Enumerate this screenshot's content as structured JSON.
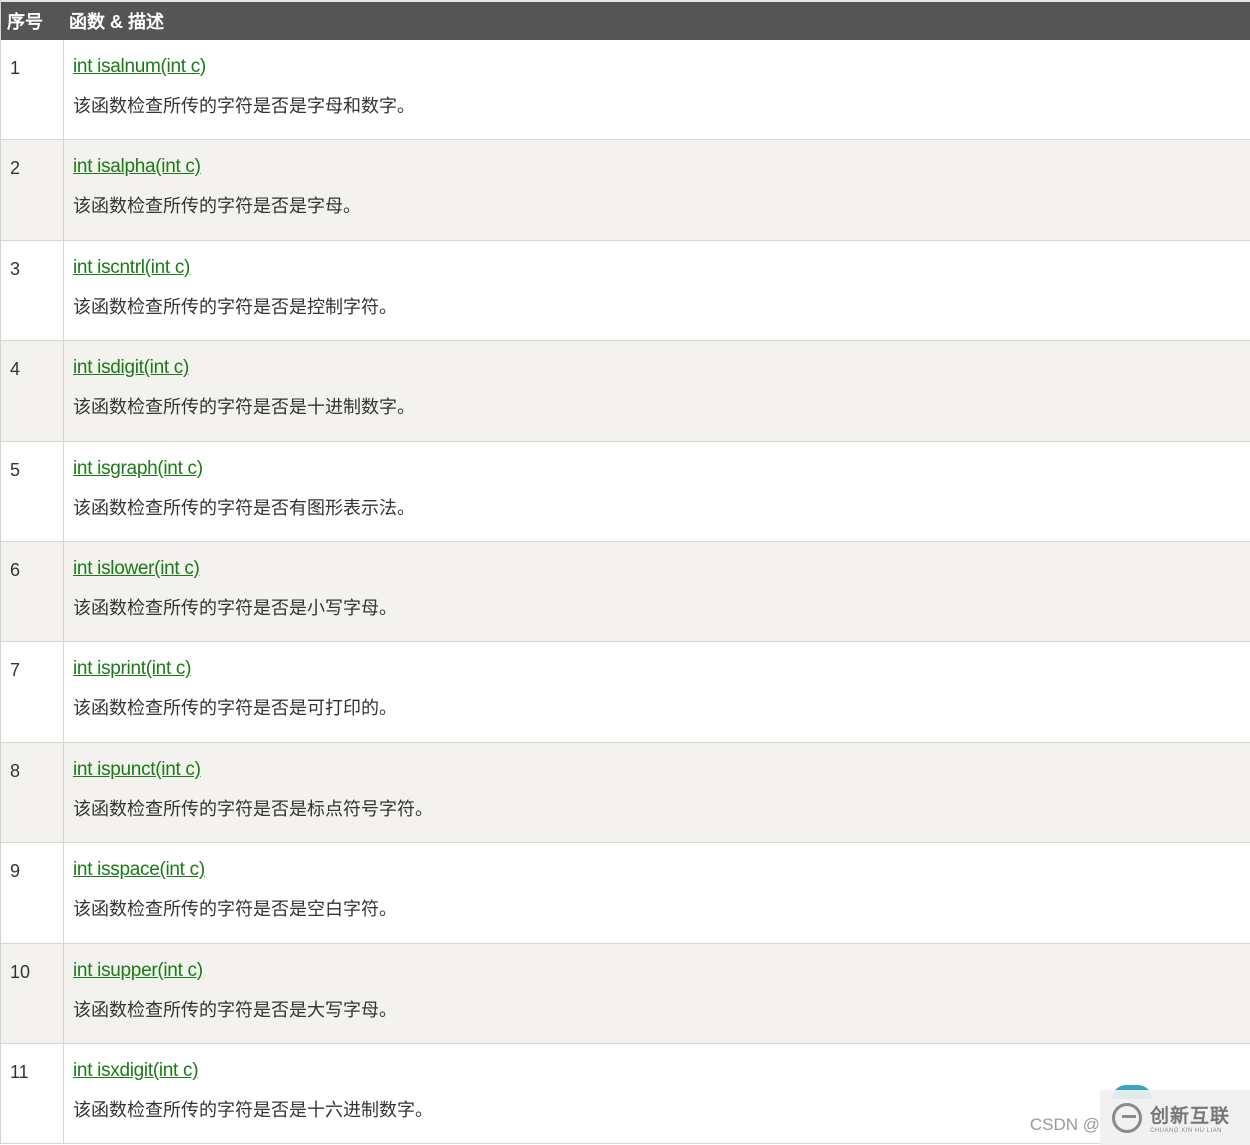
{
  "header": {
    "col1": "序号",
    "col2": "函数 & 描述"
  },
  "rows": [
    {
      "num": "1",
      "fn": "int isalnum(int c)",
      "desc": "该函数检查所传的字符是否是字母和数字。"
    },
    {
      "num": "2",
      "fn": "int isalpha(int c)",
      "desc": "该函数检查所传的字符是否是字母。"
    },
    {
      "num": "3",
      "fn": "int iscntrl(int c)",
      "desc": "该函数检查所传的字符是否是控制字符。"
    },
    {
      "num": "4",
      "fn": "int isdigit(int c)",
      "desc": "该函数检查所传的字符是否是十进制数字。"
    },
    {
      "num": "5",
      "fn": "int isgraph(int c)",
      "desc": "该函数检查所传的字符是否有图形表示法。"
    },
    {
      "num": "6",
      "fn": "int islower(int c)",
      "desc": "该函数检查所传的字符是否是小写字母。"
    },
    {
      "num": "7",
      "fn": "int isprint(int c)",
      "desc": "该函数检查所传的字符是否是可打印的。"
    },
    {
      "num": "8",
      "fn": "int ispunct(int c)",
      "desc": "该函数检查所传的字符是否是标点符号字符。"
    },
    {
      "num": "9",
      "fn": "int isspace(int c)",
      "desc": "该函数检查所传的字符是否是空白字符。"
    },
    {
      "num": "10",
      "fn": "int isupper(int c)",
      "desc": "该函数检查所传的字符是否是大写字母。"
    },
    {
      "num": "11",
      "fn": "int isxdigit(int c)",
      "desc": "该函数检查所传的字符是否是十六进制数字。"
    }
  ],
  "watermark": {
    "csdn": "CSDN @",
    "brand_cn": "创新互联",
    "brand_en": "CHUANG XIN HU LIAN"
  },
  "colors": {
    "header_bg": "#555555",
    "link": "#1a7a16",
    "alt_row": "#f3f2ef"
  }
}
